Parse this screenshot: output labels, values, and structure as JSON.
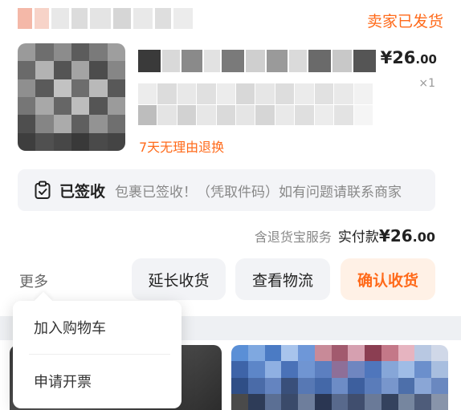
{
  "order": {
    "status": "卖家已发货"
  },
  "product": {
    "price_prefix": "¥",
    "price_int": "26",
    "price_dec": ".00",
    "quantity": "×1",
    "return_policy": "7天无理由退换"
  },
  "delivery": {
    "label": "已签收",
    "description": "包裹已签收！（凭取件码）如有问题请联系商家"
  },
  "payment": {
    "service": "含退货宝服务",
    "paid_label": "实付款",
    "amount_prefix": "¥",
    "amount_int": "26",
    "amount_dec": ".00"
  },
  "actions": {
    "more": "更多",
    "extend": "延长收货",
    "logistics": "查看物流",
    "confirm": "确认收货"
  },
  "more_menu": {
    "items": [
      "加入购物车",
      "申请开票"
    ]
  },
  "colors": {
    "accent": "#ff6a1a",
    "confirm_bg": "#fff1e6",
    "button_bg": "#f2f3f6",
    "bar_bg": "#f3f4f7"
  },
  "icons": {
    "delivery": "signed-clipboard-icon"
  }
}
